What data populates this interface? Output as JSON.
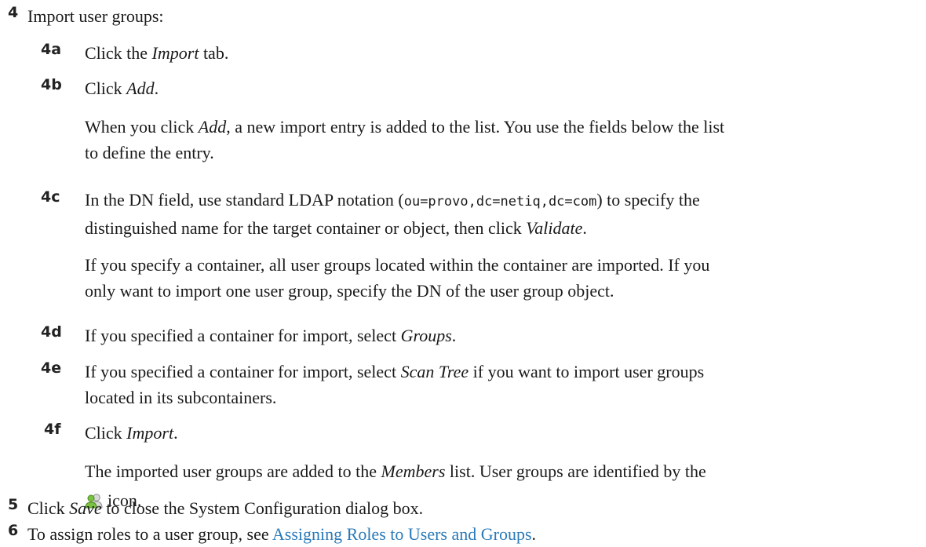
{
  "step4": {
    "num": "4",
    "text": "Import user groups:",
    "sub": {
      "a": {
        "num": "4a",
        "pre": "Click the ",
        "em": "Import",
        "post": " tab."
      },
      "b": {
        "num": "4b",
        "pre": "Click ",
        "em": "Add",
        "post": ".",
        "note_pre": "When you click ",
        "note_em": "Add",
        "note_line1_post": ", a new import entry is added to the list. You use the fields below the list",
        "note_line2": "to define the entry."
      },
      "c": {
        "num": "4c",
        "line1_pre": "In the DN field, use standard LDAP notation (",
        "line1_code": "ou=provo,dc=netiq,dc=com",
        "line1_post": ") to specify the",
        "line2_pre": "distinguished name for the target container or object, then click ",
        "line2_em": "Validate",
        "line2_post": ".",
        "note_line1": "If you specify a container, all user groups located within the container are imported. If you",
        "note_line2": "only want to import one user group, specify the DN of the user group object."
      },
      "d": {
        "num": "4d",
        "pre": "If you specified a container for import, select ",
        "em": "Groups",
        "post": "."
      },
      "e": {
        "num": "4e",
        "line1_pre": "If you specified a container for import, select ",
        "line1_em": "Scan Tree",
        "line1_post": " if you want to import user groups",
        "line2": "located in its subcontainers."
      },
      "f": {
        "num": "4f",
        "pre": "Click ",
        "em": "Import",
        "post": ".",
        "note_line1_pre": "The imported user groups are added to the ",
        "note_line1_em": "Members",
        "note_line1_post": " list. User groups are identified by the",
        "note_line2": "icon."
      }
    }
  },
  "step5": {
    "num": "5",
    "pre": "Click ",
    "em": "Save",
    "post": " to close the System Configuration dialog box."
  },
  "step6": {
    "num": "6",
    "pre": "To assign roles to a user group, see ",
    "link": "Assigning Roles to Users and Groups",
    "post": "."
  },
  "icons": {
    "user_group": "user-group-icon"
  }
}
